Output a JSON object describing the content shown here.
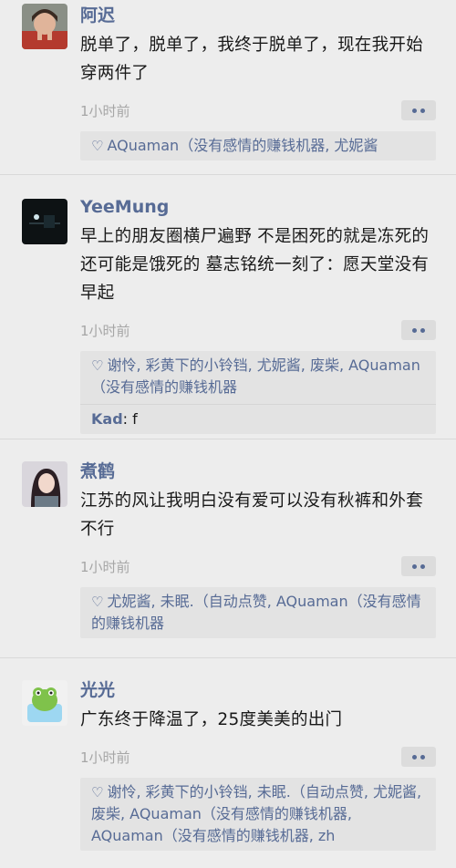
{
  "posts": [
    {
      "name": "阿迟",
      "text": "脱单了，脱单了，我终于脱单了，现在我开始穿两件了",
      "time": "1小时前",
      "likes": "AQuaman（没有感情的赚钱机器, 尤妮酱",
      "comment": null
    },
    {
      "name": "YeeMung",
      "text": "早上的朋友圈横尸遍野 不是困死的就是冻死的还可能是饿死的 墓志铭统一刻了：愿天堂没有早起",
      "time": "1小时前",
      "likes": "谢怜, 彩黄下的小铃铛, 尤妮酱, 废柴, AQuaman（没有感情的赚钱机器",
      "comment": {
        "who": "Kad",
        "text": ": f"
      }
    },
    {
      "name": "煮鹤",
      "text": "江苏的风让我明白没有爱可以没有秋裤和外套不行",
      "time": "1小时前",
      "likes": "尤妮酱, 未眠.（自动点赞, AQuaman（没有感情的赚钱机器",
      "comment": null
    },
    {
      "name": "光光",
      "text": "广东终于降温了，25度美美的出门",
      "time": "1小时前",
      "likes": "谢怜, 彩黄下的小铃铛, 未眠.（自动点赞, 尤妮酱, 废柴, AQuaman（没有感情的赚钱机器, AQuaman（没有感情的赚钱机器, zh",
      "comment": null
    }
  ]
}
